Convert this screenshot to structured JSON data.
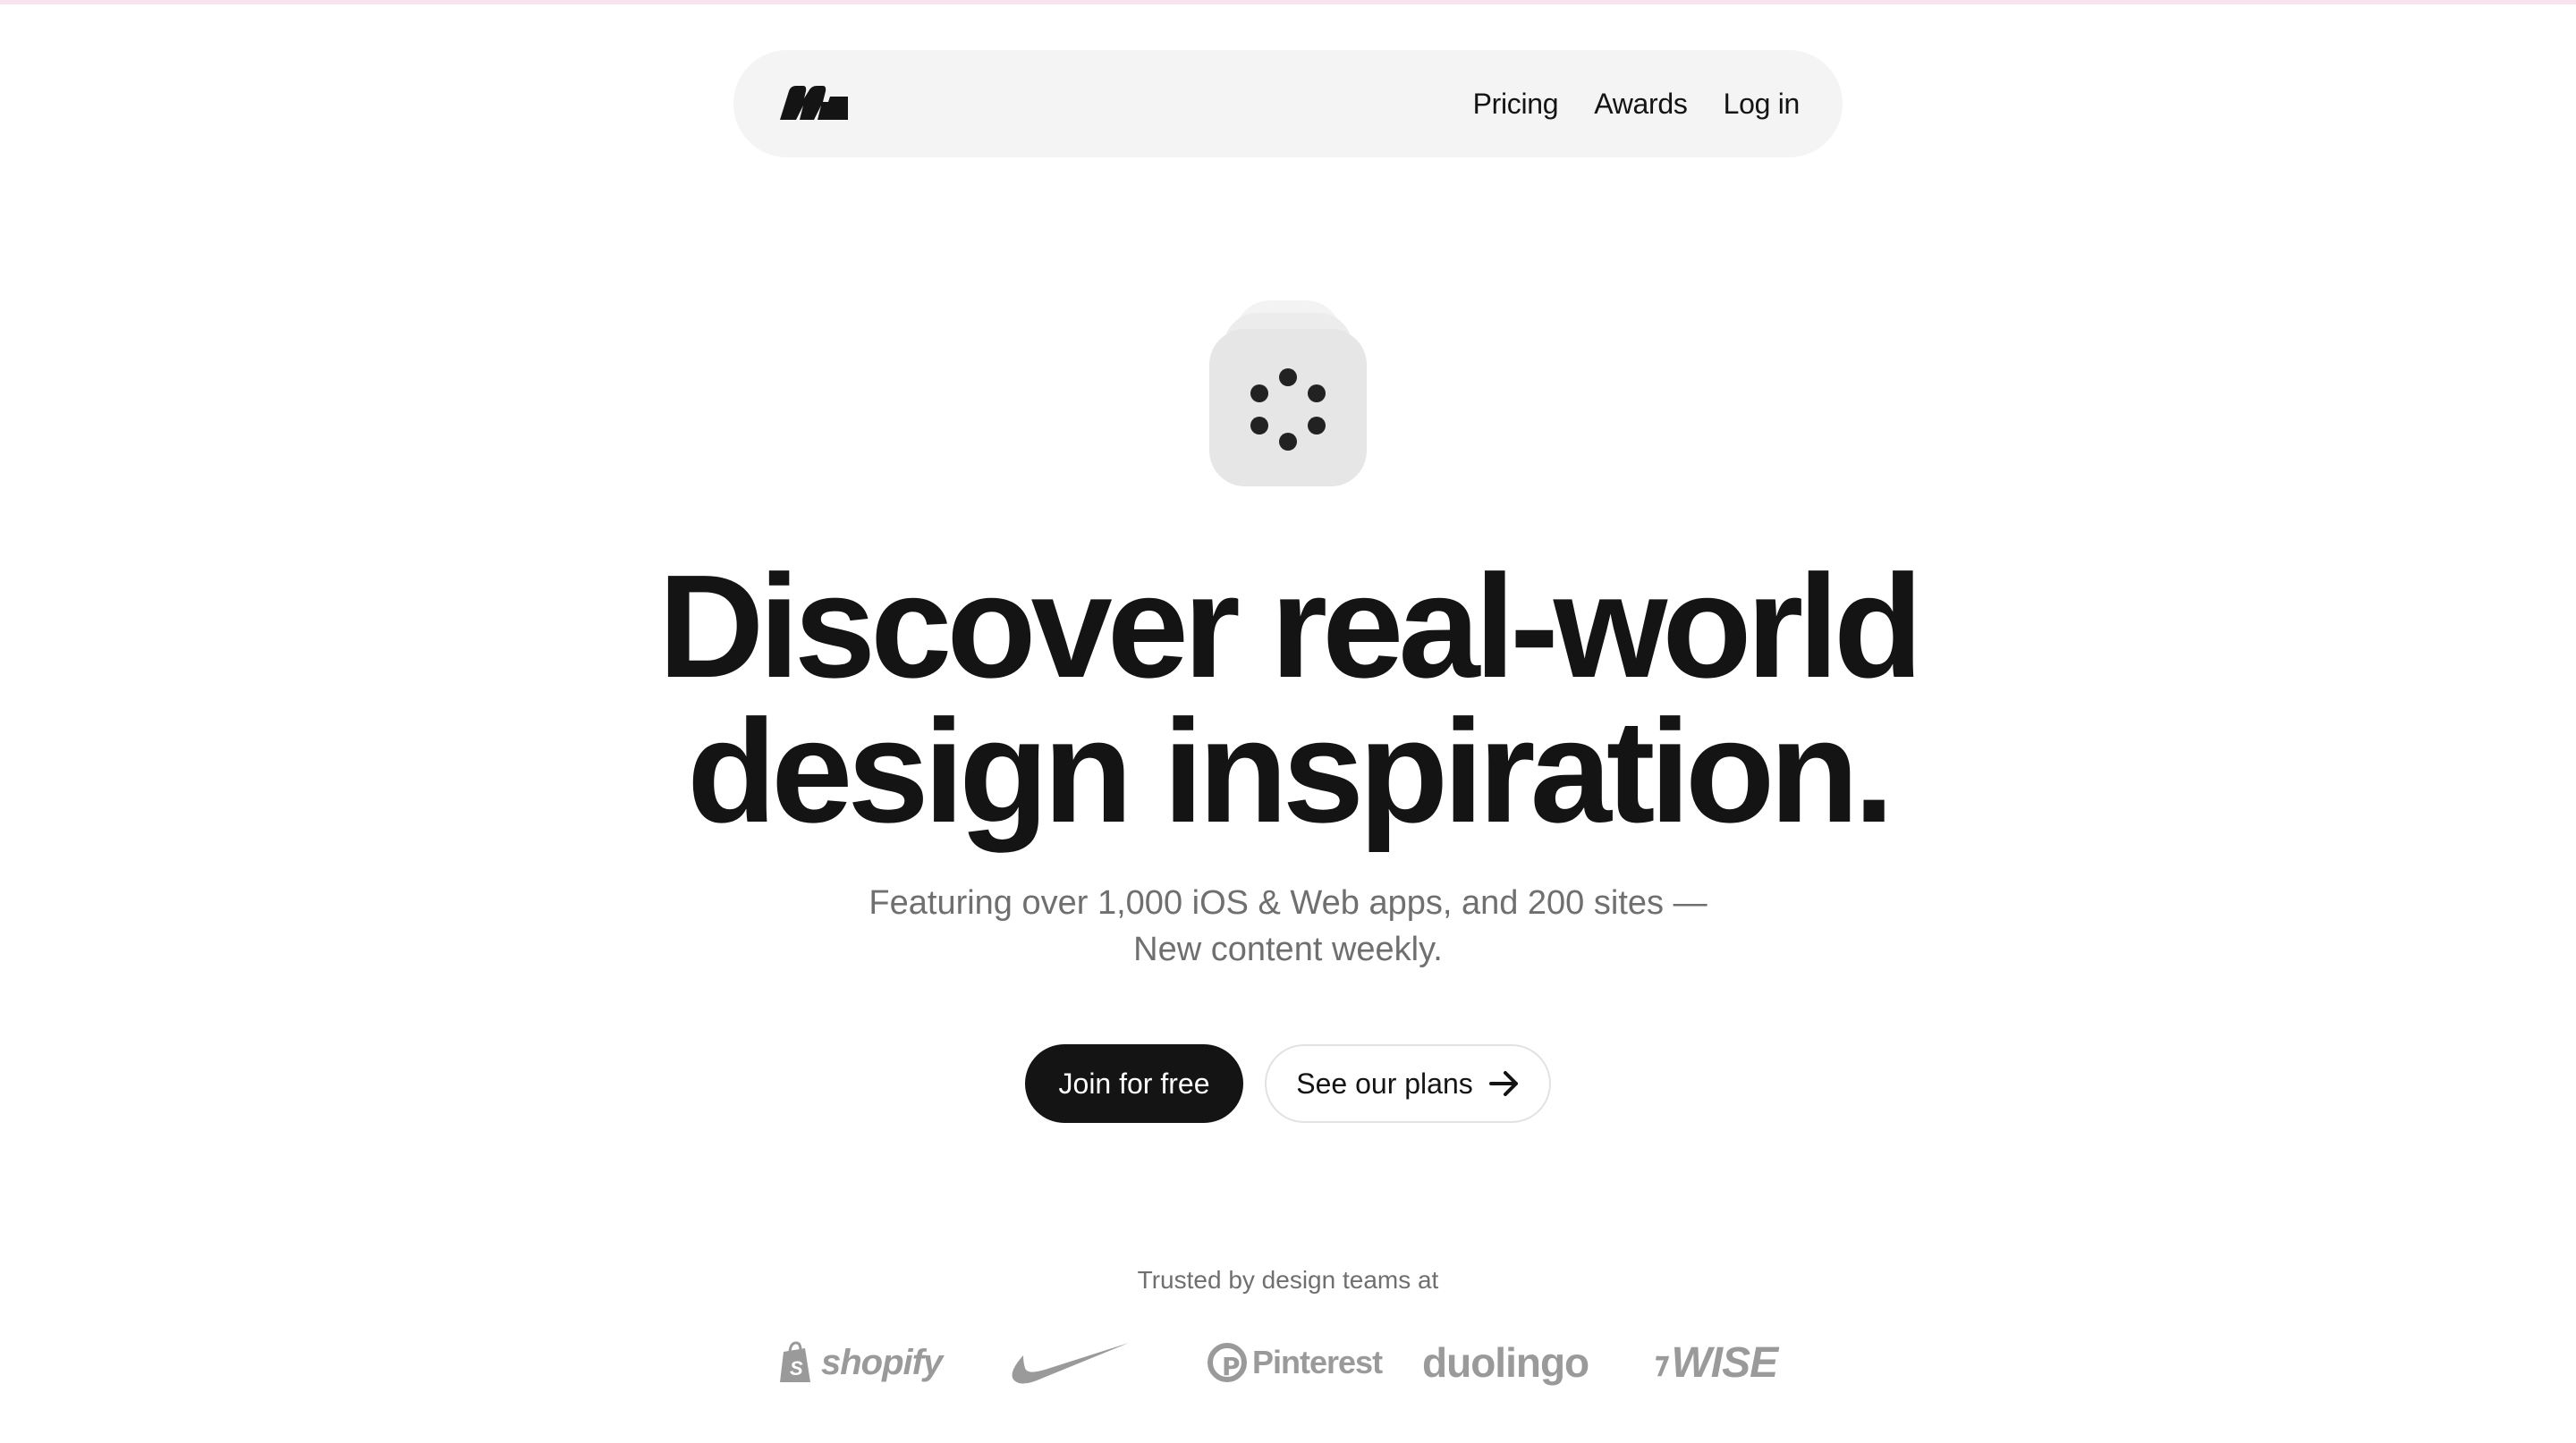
{
  "nav": {
    "logo": "mobbin-logo",
    "links": [
      "Pricing",
      "Awards",
      "Log in"
    ]
  },
  "hero": {
    "icon": "loading-dots-icon",
    "headline_line1": "Discover real-world",
    "headline_line2": "design inspiration.",
    "subhead_line1": "Featuring over 1,000 iOS & Web apps, and 200 sites —",
    "subhead_line2": "New content weekly."
  },
  "cta": {
    "primary_label": "Join for free",
    "secondary_label": "See our plans"
  },
  "trusted": {
    "label": "Trusted by design teams at",
    "brands": [
      "shopify",
      "Nike",
      "Pinterest",
      "duolingo",
      "WISE"
    ]
  },
  "colors": {
    "text": "#141414",
    "muted": "#6f6f6f",
    "nav_bg": "#f4f4f4",
    "brand_gray": "#9a9a9a",
    "top_accent": "#f8e3ee"
  }
}
